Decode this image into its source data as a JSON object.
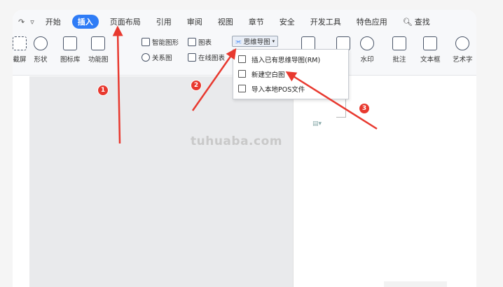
{
  "quick_access": {
    "redo_glyph": "↷",
    "dropdown_glyph": "▿"
  },
  "tabs": [
    {
      "label": "开始",
      "active": false
    },
    {
      "label": "插入",
      "active": true
    },
    {
      "label": "页面布局",
      "active": false
    },
    {
      "label": "引用",
      "active": false
    },
    {
      "label": "审阅",
      "active": false
    },
    {
      "label": "视图",
      "active": false
    },
    {
      "label": "章节",
      "active": false
    },
    {
      "label": "安全",
      "active": false
    },
    {
      "label": "开发工具",
      "active": false
    },
    {
      "label": "特色应用",
      "active": false
    }
  ],
  "search_label": "查找",
  "ribbon": {
    "screenshot": "截屏",
    "shape": "形状",
    "icon_lib": "图标库",
    "func_chart": "功能图",
    "smart_shape": "智能图形",
    "chart": "图表",
    "relation": "关系图",
    "online_chart": "在线图表",
    "mindmap": "思维导图",
    "watermark": "水印",
    "comment": "批注",
    "textbox": "文本框",
    "art_text": "艺术字"
  },
  "dropdown": [
    "插入已有思维导图(RM)",
    "新建空白图",
    "导入本地POS文件"
  ],
  "annotations": {
    "badge_1": "1",
    "badge_2": "2",
    "badge_3": "3",
    "arrow_color": "#e8392f"
  },
  "watermark": "tuhuaba.com",
  "colors": {
    "accent": "#2f7cf6",
    "badge": "#e8392f"
  }
}
